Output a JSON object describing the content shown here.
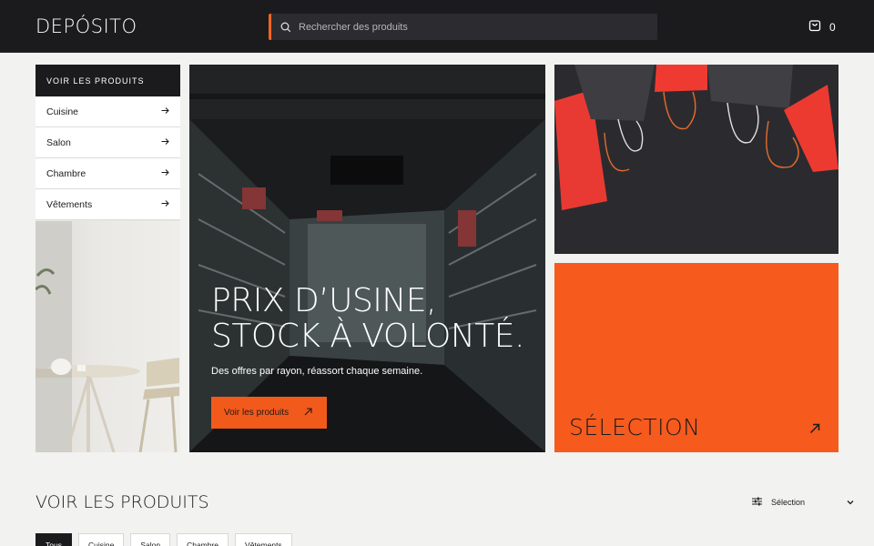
{
  "header": {
    "logo": "DEPÓSITO",
    "search_placeholder": "Rechercher des produits",
    "cart_count": "0"
  },
  "categories": {
    "heading": "VOIR LES PRODUITS",
    "items": [
      {
        "label": "Cuisine"
      },
      {
        "label": "Salon"
      },
      {
        "label": "Chambre"
      },
      {
        "label": "Vêtements"
      }
    ]
  },
  "hero": {
    "title": "PRIX D’USINE,\nSTOCK À VOLONTÉ.",
    "subtitle": "Des offres par rayon, réassort chaque semaine.",
    "button_label": "Voir les produits"
  },
  "selection_tile": {
    "label": "SÉLECTION"
  },
  "products_section": {
    "title": "VOIR LES PRODUITS",
    "sort_value": "Sélection",
    "filter_tabs": [
      {
        "label": "Tous",
        "active": true
      },
      {
        "label": "Cuisine",
        "active": false
      },
      {
        "label": "Salon",
        "active": false
      },
      {
        "label": "Chambre",
        "active": false
      },
      {
        "label": "Vêtements",
        "active": false
      }
    ]
  },
  "colors": {
    "header_bg": "#1b1b1e",
    "accent_orange": "#f65a1c",
    "page_bg": "#f2f2f0"
  },
  "icons": [
    "search-icon",
    "cart-icon",
    "arrow-right-icon",
    "arrow-up-right-icon",
    "sliders-icon",
    "chevron-down-icon"
  ]
}
